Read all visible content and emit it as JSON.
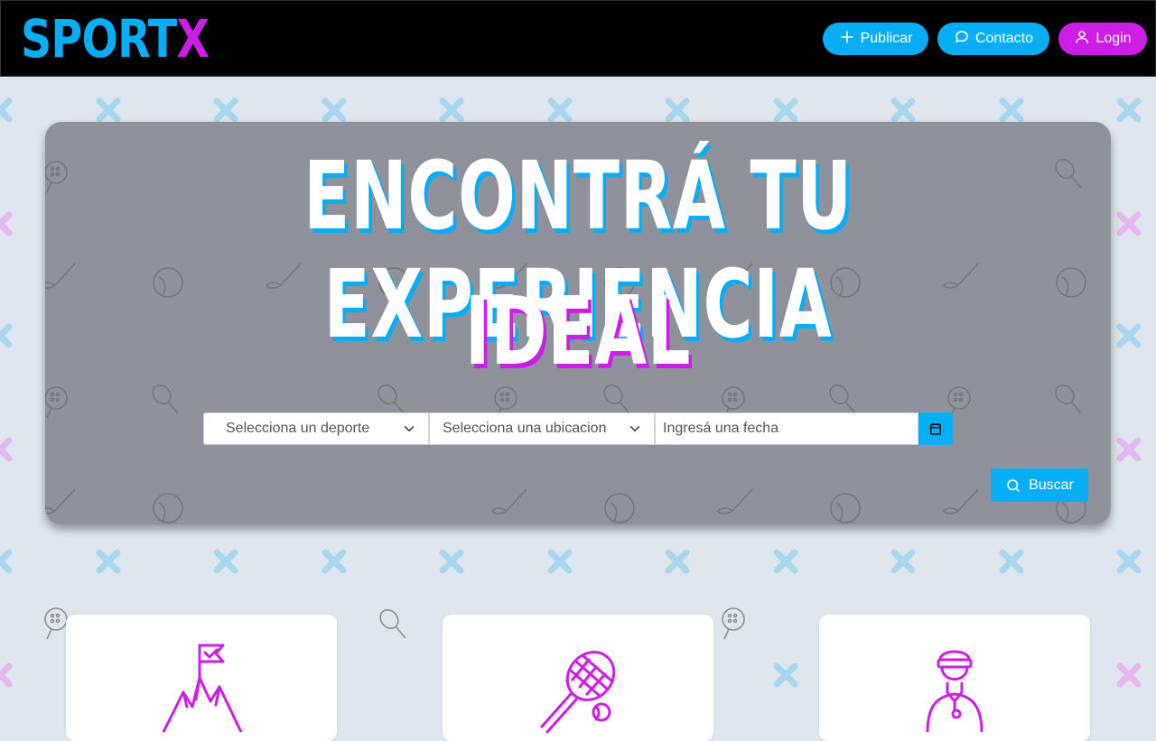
{
  "brand": {
    "logo_part1": "SPORT",
    "logo_part2": "X"
  },
  "nav": {
    "publicar": "Publicar",
    "contacto": "Contacto",
    "login": "Login"
  },
  "hero": {
    "title_line1": "ENCONTRÁ TU EXPERIENCIA",
    "title_line2": "IDEAL"
  },
  "search": {
    "sport_select": "Selecciona un deporte",
    "location_select": "Selecciona una ubicacion",
    "date_placeholder": "Ingresá una fecha",
    "button": "Buscar"
  },
  "cards": [
    {
      "icon": "mountain-flag-icon"
    },
    {
      "icon": "tennis-racket-icon"
    },
    {
      "icon": "coach-person-icon"
    }
  ],
  "colors": {
    "accent_blue": "#08aef5",
    "accent_purple": "#cc1ee6",
    "navbar": "#000000",
    "page_bg": "#dfe6ee"
  }
}
